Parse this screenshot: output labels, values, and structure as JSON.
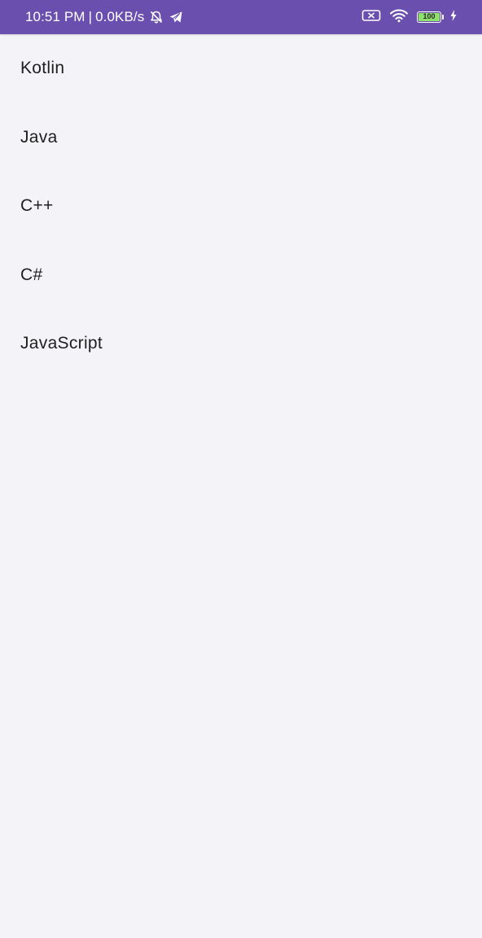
{
  "status_bar": {
    "time": "10:51 PM",
    "separator": "|",
    "network_speed": "0.0KB/s",
    "battery_percent": "100",
    "battery_level": 1.0,
    "icons": [
      "muted-bell-icon",
      "telegram-icon",
      "no-sim-icon",
      "wifi-icon",
      "battery-icon",
      "charging-icon"
    ],
    "colors": {
      "background": "#6a4fae",
      "battery_fill": "#8ee06e"
    }
  },
  "list": {
    "items": [
      {
        "label": "Kotlin"
      },
      {
        "label": "Java"
      },
      {
        "label": "C++"
      },
      {
        "label": "C#"
      },
      {
        "label": "JavaScript"
      }
    ]
  },
  "theme": {
    "background": "#f4f3f8",
    "text": "#1f1f1f"
  }
}
